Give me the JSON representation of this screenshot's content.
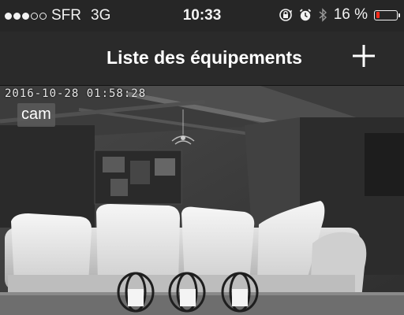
{
  "status_bar": {
    "carrier": "SFR",
    "network": "3G",
    "time": "10:33",
    "battery_text": "16 %",
    "battery_level": 0.16,
    "signal_bars_filled": 3,
    "signal_bars_total": 5,
    "icons": [
      "signal-dots-icon",
      "rotation-lock-icon",
      "alarm-icon",
      "bluetooth-icon",
      "battery-icon"
    ],
    "battery_color": "#ff2a1a"
  },
  "nav_bar": {
    "title": "Liste des équipements",
    "add_icon": "plus-icon"
  },
  "camera": {
    "timestamp": "2016-10-28 01:58:28",
    "label": "cam"
  }
}
